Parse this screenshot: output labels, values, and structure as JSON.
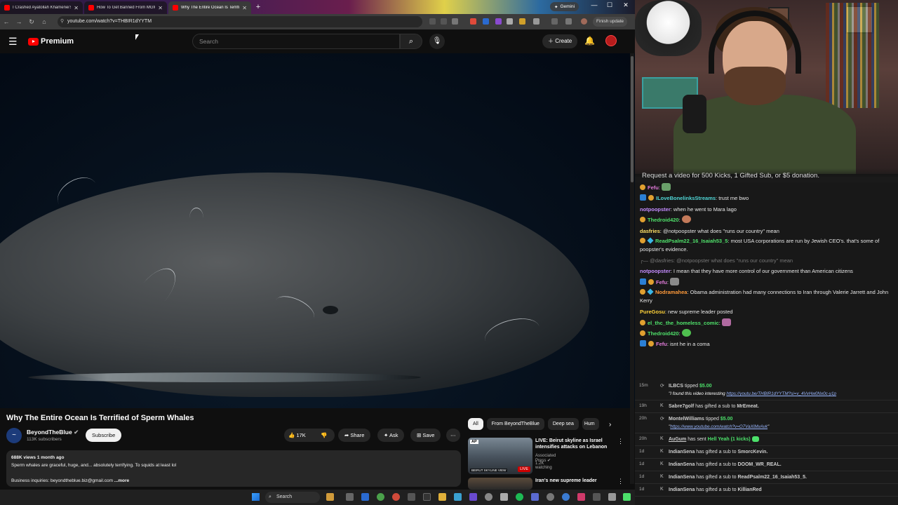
{
  "browser": {
    "tabs": [
      {
        "label": "I Crashed Ayatollah Khamenei's",
        "active": false
      },
      {
        "label": "How To Get Banned From MGM",
        "active": false
      },
      {
        "label": "Why The Entire Ocean Is Terrifi",
        "active": true
      }
    ],
    "gemini_label": "Gemini",
    "url": "youtube.com/watch?v=THBIR1dYYTM",
    "finish_update": "Finish update"
  },
  "youtube": {
    "brand": "Premium",
    "search_placeholder": "Search",
    "create_label": "Create",
    "video_title": "Why The Entire Ocean Is Terrified of Sperm Whales",
    "channel_name": "BeyondTheBlue",
    "channel_subs": "113K subscribers",
    "subscribe_label": "Subscribe",
    "like_count": "17K",
    "share_label": "Share",
    "ask_label": "Ask",
    "save_label": "Save",
    "views_age": "688K views  1 month ago",
    "desc_line1": "Sperm whales are graceful, huge, and... absolutely terrifying. To squids at least lol",
    "desc_line2": "Business inquiries: beyondtheblue.biz@gmail.com",
    "desc_more": "...more",
    "chips": [
      "All",
      "From BeyondTheBlue",
      "Deep sea",
      "Hum"
    ],
    "recommendations": [
      {
        "title": "LIVE: Beirut skyline as Israel intensifies attacks on Lebanon",
        "channel": "Associated Press",
        "meta": "1.2K watching",
        "badge": "LIVE",
        "thumb_caption": "BEIRUT SKYLINE VIEW",
        "source_badge": "AP"
      },
      {
        "title": "Iran's new supreme leader"
      }
    ]
  },
  "stream": {
    "request_text": "Request a video for 500 Kicks, 1 Gifted Sub, or $5 donation."
  },
  "chat": [
    {
      "user": "Fefu",
      "text": "",
      "color": "#e07ad8",
      "emote": "#6aa06a"
    },
    {
      "user": "ILoveBonelinksStreams",
      "text": "trust me bwo",
      "color": "#4fd6d6"
    },
    {
      "user": "notpoopster",
      "text": "when he went to Mara lago",
      "color": "#c48cff"
    },
    {
      "user": "Thedroid420",
      "text": "",
      "color": "#4fe06a",
      "emote": "#c47a5a"
    },
    {
      "user": "dasfries",
      "text": "@notpoopster what does \"runs our country\" mean",
      "color": "#ffe066"
    },
    {
      "user": "ReadPsalm22_16_Isaiah53_5",
      "text": "most USA corporations are run by Jewish CEO's. that's some of poopster's evidence.",
      "color": "#4fe06a"
    },
    {
      "reply": "@dasfries: @notpoopster what does \"runs our country\" mean"
    },
    {
      "user": "notpoopster",
      "text": "I mean that they have more control of our government than American citizens",
      "color": "#c48cff"
    },
    {
      "user": "Fefu",
      "text": "",
      "color": "#e07ad8",
      "emote": "#8a8a8a"
    },
    {
      "user": "Nodramahea",
      "text": "Obama administration had many connections to Iran through Valerie Jarrett and John Kerry",
      "color": "#ff9a3a"
    },
    {
      "user": "PureGosu",
      "text": "new supreme leader posted",
      "color": "#ffd23a"
    },
    {
      "user": "el_thc_the_homeless_comic",
      "text": "",
      "color": "#4fe06a",
      "emote": "#b06aa0"
    },
    {
      "user": "Thedroid420",
      "text": "",
      "color": "#4fe06a",
      "emote": "#4fc04f"
    },
    {
      "user": "Fefu",
      "text": "isnt he in a coma",
      "color": "#e07ad8"
    }
  ],
  "events": [
    {
      "time": "15m",
      "user": "ILBCS",
      "action": "tipped",
      "amount": "$5.00",
      "quote": "\"I found this video interesting ",
      "link": "https://youtu.be/THBIR1dYYTM?si=v_4VvHw0Nx0c-y1p"
    },
    {
      "time": "19h",
      "user": "Sabre7golf",
      "action": "has gifted a sub to",
      "target": "MrEmeat."
    },
    {
      "time": "20h",
      "user": "MontelWilliams",
      "action": "tipped",
      "amount": "$5.00",
      "link": "https://www.youtube.com/watch?v=O7VaXlMvAvk"
    },
    {
      "time": "20h",
      "user": "AuGum",
      "action": "has sent",
      "amount": "Hell Yeah (1 kicks)"
    },
    {
      "time": "1d",
      "user": "IndianSena",
      "action": "has gifted a sub to",
      "target": "SmorcKevin."
    },
    {
      "time": "1d",
      "user": "IndianSena",
      "action": "has gifted a sub to",
      "target": "DOOM_WR_REAL."
    },
    {
      "time": "1d",
      "user": "IndianSena",
      "action": "has gifted a sub to",
      "target": "ReadPsalm22_16_Isaiah53_5."
    },
    {
      "time": "1d",
      "user": "IndianSena",
      "action": "has gifted a sub to",
      "target": "KillianRed"
    }
  ],
  "taskbar": {
    "search_label": "Search"
  },
  "colors": {
    "youtube_red": "#ff0000",
    "kick_green": "#4ce06a",
    "bg": "#0f0f0f"
  },
  "icons": [
    "hamburger-icon",
    "search-icon",
    "mic-icon",
    "bell-icon",
    "like-icon",
    "dislike-icon",
    "share-icon",
    "sparkle-icon",
    "save-icon",
    "more-icon",
    "chevron-right-icon"
  ]
}
